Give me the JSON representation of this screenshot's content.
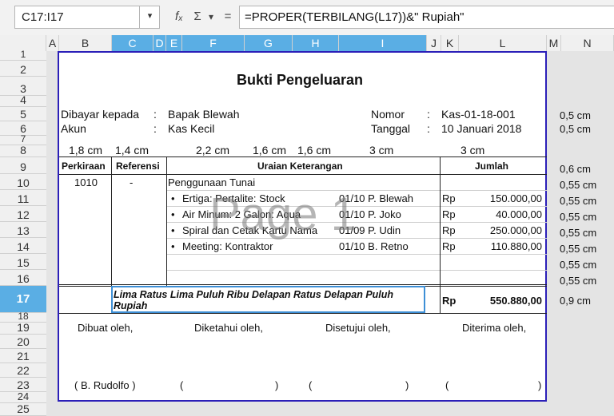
{
  "formula_bar": {
    "name_box": "C17:I17",
    "name_box_arrow_icon": "chevron-down-icon",
    "function_wizard_icon": "function-wizard-icon",
    "sum_icon": "sum-icon",
    "equals_icon": "equals-icon",
    "fx": "fₓ",
    "sigma": "Σ",
    "caret": "▾",
    "equals": "=",
    "formula": "=PROPER(TERBILANG(L17))&\" Rupiah\""
  },
  "columns": [
    "A",
    "B",
    "C",
    "D",
    "E",
    "F",
    "G",
    "H",
    "I",
    "J",
    "K",
    "L",
    "M",
    "N"
  ],
  "rows": [
    "1",
    "2",
    "3",
    "4",
    "5",
    "6",
    "7",
    "8",
    "9",
    "10",
    "11",
    "12",
    "13",
    "14",
    "15",
    "16",
    "17",
    "18",
    "19",
    "20",
    "21",
    "22",
    "23",
    "24",
    "25"
  ],
  "selection": {
    "row": "17",
    "columns": [
      "C",
      "D",
      "E",
      "F",
      "G",
      "H",
      "I"
    ]
  },
  "doc": {
    "title": "Bukti Pengeluaran",
    "dibayar_label": "Dibayar kepada",
    "dibayar_colon": ":",
    "dibayar_value": "Bapak Blewah",
    "akun_label": "Akun",
    "akun_colon": ":",
    "akun_value": "Kas Kecil",
    "nomor_label": "Nomor",
    "nomor_colon": ":",
    "nomor_value": "Kas-01-18-001",
    "tanggal_label": "Tanggal",
    "tanggal_colon": ":",
    "tanggal_value": "10 Januari 2018",
    "widths": [
      "1,8 cm",
      "1,4 cm",
      "2,2 cm",
      "1,6 cm",
      "1,6 cm",
      "3 cm",
      "3 cm"
    ],
    "headers": {
      "perkiraan": "Perkiraan",
      "referensi": "Referensi",
      "uraian": "Uraian Keterangan",
      "jumlah": "Jumlah"
    },
    "row10": {
      "perkiraan": "1010",
      "referensi": "-",
      "uraian": "Penggunaan Tunai"
    },
    "items": [
      {
        "desc": "Ertiga: Pertalite: Stock",
        "ref": "01/10 P. Blewah",
        "cur": "Rp",
        "amount": "150.000,00"
      },
      {
        "desc": "Air Minum: 2 Galon: Aqua",
        "ref": "01/10 P. Joko",
        "cur": "Rp",
        "amount": "40.000,00"
      },
      {
        "desc": "Spiral dan Cetak Kartu Nama",
        "ref": "01/09 P. Udin",
        "cur": "Rp",
        "amount": "250.000,00"
      },
      {
        "desc": "Meeting: Kontraktor",
        "ref": "01/10 B. Retno",
        "cur": "Rp",
        "amount": "110.880,00"
      }
    ],
    "bullet": "•",
    "terbilang": "Lima Ratus Lima Puluh Ribu Delapan Ratus Delapan Puluh Rupiah",
    "total_cur": "Rp",
    "total_amount": "550.880,00",
    "sign": {
      "dibuat": "Dibuat oleh,",
      "diketahui": "Diketahui oleh,",
      "disetujui": "Disetujui oleh,",
      "diterima": "Diterima oleh,",
      "dibuat_name": "( B. Rudolfo )",
      "paren_open": "(",
      "paren_close": ")"
    },
    "watermark": "Page 1"
  },
  "row_heights": {
    "r5": "0,5 cm",
    "r6": "0,5 cm",
    "r9": "0,6 cm",
    "r10": "0,55 cm",
    "r11": "0,55 cm",
    "r12": "0,55 cm",
    "r13": "0,55 cm",
    "r14": "0,55 cm",
    "r15": "0,55 cm",
    "r16": "0,55 cm",
    "r17": "0,9 cm"
  }
}
